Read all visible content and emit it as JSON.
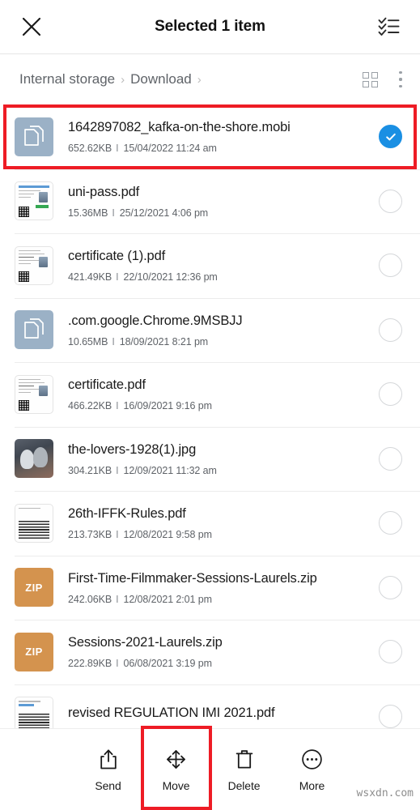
{
  "appbar": {
    "close_icon": "close-icon",
    "title": "Selected 1 item",
    "select_all_icon": "select-all-checklist-icon"
  },
  "pathbar": {
    "crumbs": [
      "Internal storage",
      "Download"
    ],
    "separator": "›",
    "grid_view_icon": "grid-view-icon",
    "overflow_icon": "kebab-menu-icon"
  },
  "list": {
    "size_date_separator": "I",
    "files": [
      {
        "name": "1642897082_kafka-on-the-shore.mobi",
        "size": "652.62KB",
        "date": "15/04/2022 11:24 am",
        "icon": "generic-file-icon",
        "selected": true,
        "highlighted": true
      },
      {
        "name": "uni-pass.pdf",
        "size": "15.36MB",
        "date": "25/12/2021 4:06 pm",
        "icon": "pdf-id-card-thumbnail",
        "selected": false,
        "highlighted": false
      },
      {
        "name": "certificate (1).pdf",
        "size": "421.49KB",
        "date": "22/10/2021 12:36 pm",
        "icon": "pdf-document-thumbnail",
        "selected": false,
        "highlighted": false
      },
      {
        "name": ".com.google.Chrome.9MSBJJ",
        "size": "10.65MB",
        "date": "18/09/2021 8:21 pm",
        "icon": "generic-file-icon",
        "selected": false,
        "highlighted": false
      },
      {
        "name": "certificate.pdf",
        "size": "466.22KB",
        "date": "16/09/2021 9:16 pm",
        "icon": "pdf-document-thumbnail",
        "selected": false,
        "highlighted": false
      },
      {
        "name": "the-lovers-1928(1).jpg",
        "size": "304.21KB",
        "date": "12/09/2021 11:32 am",
        "icon": "image-photo-thumbnail",
        "selected": false,
        "highlighted": false
      },
      {
        "name": "26th-IFFK-Rules.pdf",
        "size": "213.73KB",
        "date": "12/08/2021 9:58 pm",
        "icon": "pdf-text-thumbnail",
        "selected": false,
        "highlighted": false
      },
      {
        "name": "First-Time-Filmmaker-Sessions-Laurels.zip",
        "size": "242.06KB",
        "date": "12/08/2021 2:01 pm",
        "icon": "zip-archive-icon",
        "icon_label": "ZIP",
        "selected": false,
        "highlighted": false
      },
      {
        "name": "Sessions-2021-Laurels.zip",
        "size": "222.89KB",
        "date": "06/08/2021 3:19 pm",
        "icon": "zip-archive-icon",
        "icon_label": "ZIP",
        "selected": false,
        "highlighted": false
      },
      {
        "name": "revised REGULATION IMI 2021.pdf",
        "size": "",
        "date": "",
        "icon": "pdf-text-thumbnail",
        "selected": false,
        "highlighted": false
      }
    ]
  },
  "bottombar": {
    "actions": [
      {
        "label": "Send",
        "icon": "share-upload-icon",
        "highlighted": false
      },
      {
        "label": "Move",
        "icon": "move-arrows-icon",
        "highlighted": true
      },
      {
        "label": "Delete",
        "icon": "trash-can-icon",
        "highlighted": false
      },
      {
        "label": "More",
        "icon": "more-circle-icon",
        "highlighted": false
      }
    ]
  },
  "watermark": "wsxdn.com",
  "colors": {
    "accent_blue": "#1a8fe3",
    "annotation_red": "#ee1c25",
    "zip_orange": "#d4934e",
    "generic_file_blue": "#9bb1c6"
  }
}
